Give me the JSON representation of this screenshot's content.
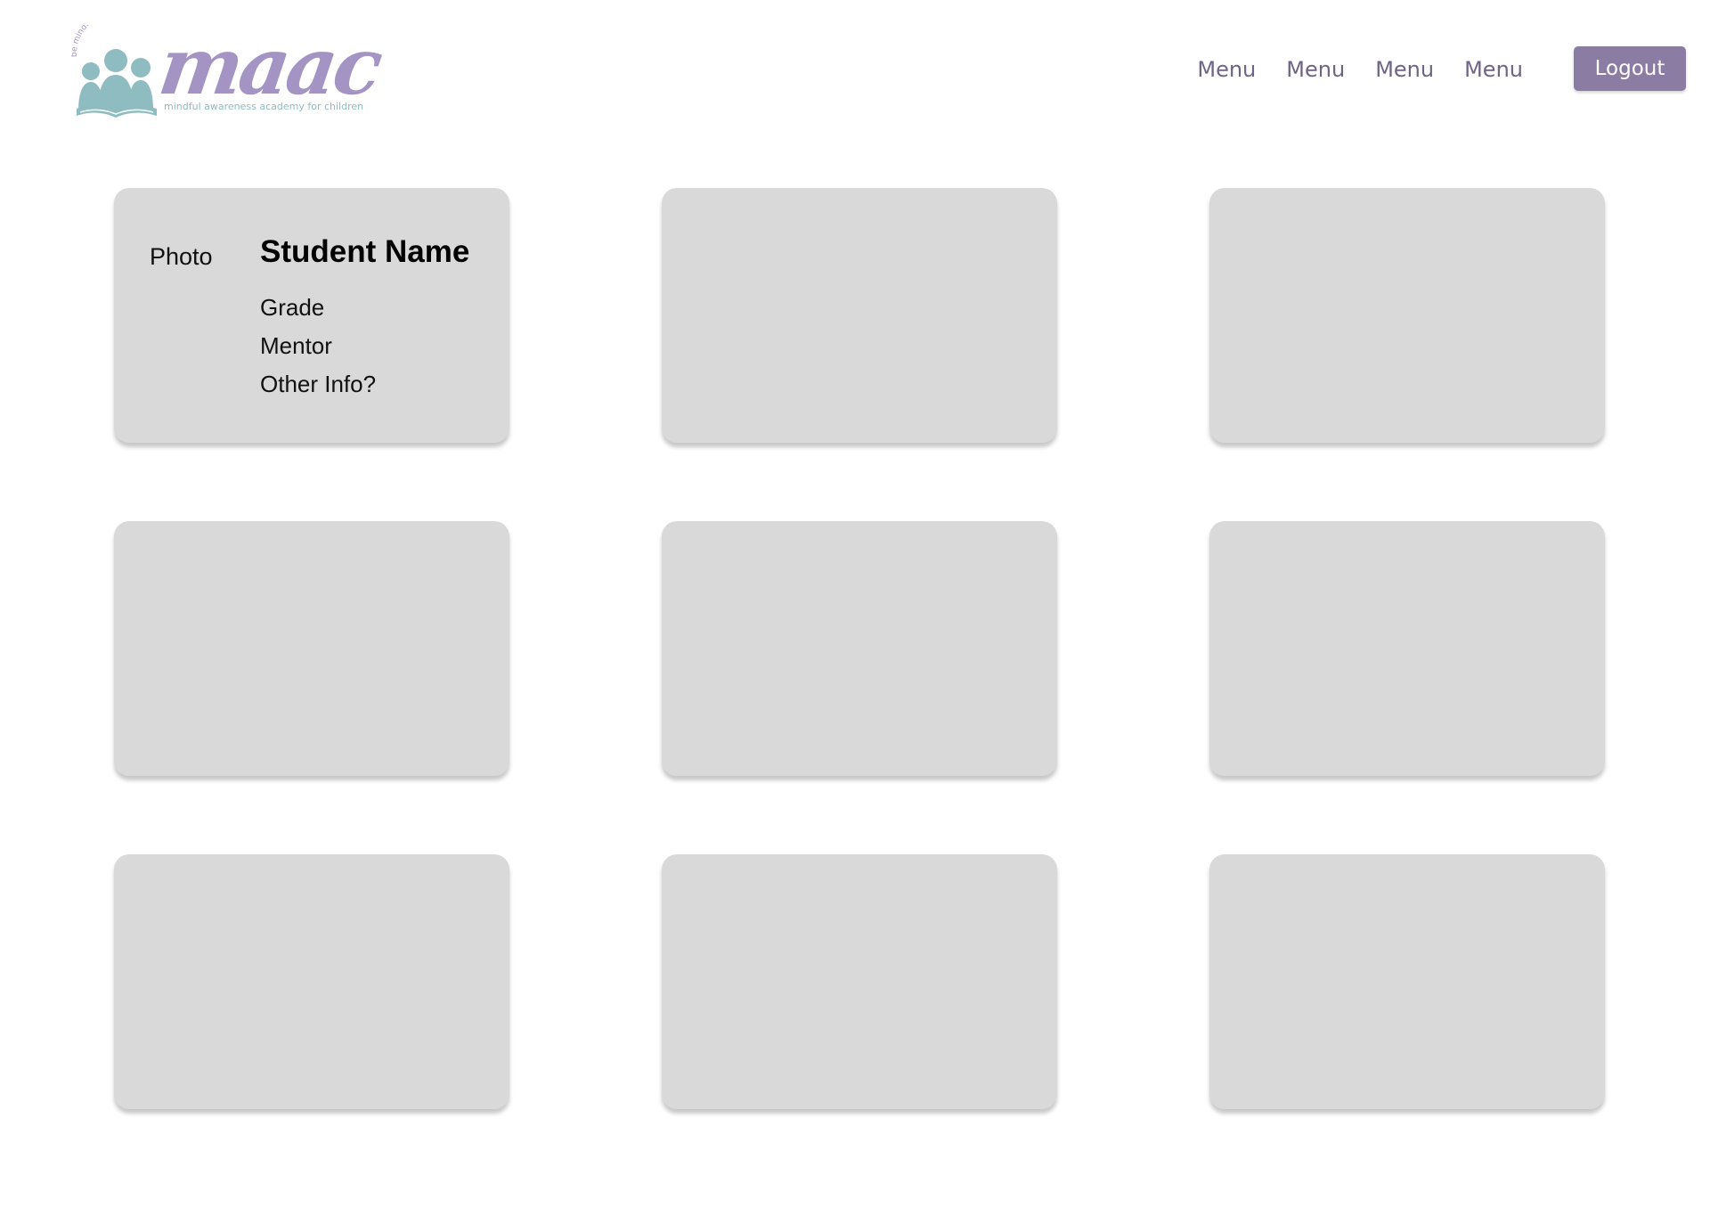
{
  "header": {
    "logo": {
      "wordmark": "maac",
      "tagline": "mindful awareness academy for children",
      "arc_text": "be mindful • be brilliant",
      "colors": {
        "wordmark": "#a494c4",
        "figures": "#8fbcc0"
      }
    },
    "nav": [
      {
        "label": "Menu"
      },
      {
        "label": "Menu"
      },
      {
        "label": "Menu"
      },
      {
        "label": "Menu"
      }
    ],
    "logout_label": "Logout"
  },
  "colors": {
    "accent": "#8a7ca3",
    "nav_text": "#6f6486",
    "card_bg": "#d9d9d9",
    "page_bg": "#ffffff"
  },
  "cards": [
    {
      "photo_label": "Photo",
      "name": "Student Name",
      "fields": [
        "Grade",
        "Mentor",
        "Other Info?"
      ]
    },
    {},
    {},
    {},
    {},
    {},
    {},
    {},
    {}
  ]
}
